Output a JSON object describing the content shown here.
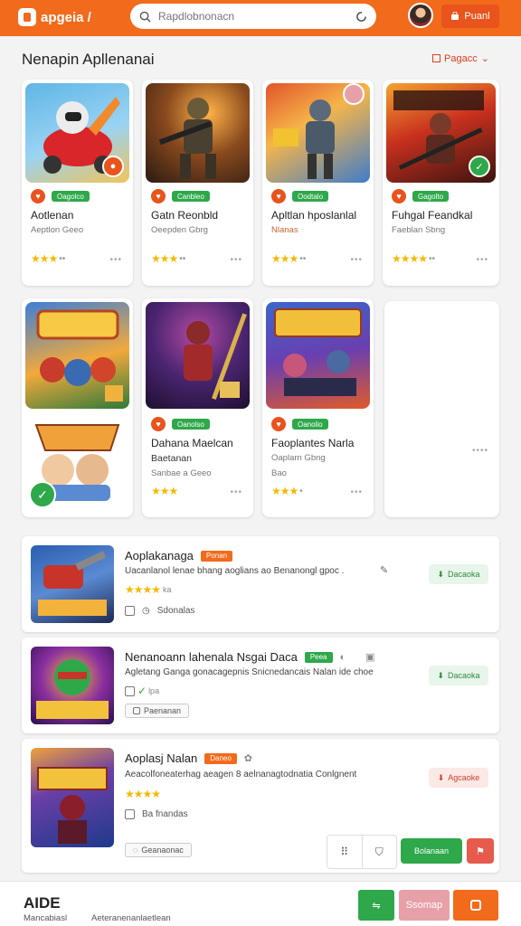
{
  "header": {
    "logo_text": "apgeia /",
    "search_placeholder": "Rapdlobnonacn",
    "action_label": "Puanl"
  },
  "section": {
    "title": "Nenapin Apllenanai",
    "action_label": "Pagacc"
  },
  "grid": [
    {
      "title": "Aotlenan",
      "sub": "Aeptlon Geeo",
      "pill": "Oagolco",
      "dots": "•••"
    },
    {
      "title": "Gatn Reonbld",
      "sub": "Oeepden Gbrg",
      "pill": "Canbleo",
      "dots": "•••"
    },
    {
      "title": "Apltlan hposlanlal",
      "sub": "Nlanas",
      "pill": "Oodtalo",
      "dots": "•••"
    },
    {
      "title": "Fuhgal Feandkal",
      "sub": "Faeblan Sbng",
      "pill": "Gagolto",
      "dots": "•••"
    },
    {
      "title": "",
      "sub": "",
      "pill": "",
      "dots": ""
    },
    {
      "title": "Dahana Maelcan",
      "sub": "Baetanan",
      "sub2": "Sanbae a Geeo",
      "pill": "Oanolso",
      "dots": "•••"
    },
    {
      "title": "Faoplantes Narla",
      "sub": "Oaplarn Gbng",
      "sub2": "Bao",
      "pill": "Oanolio",
      "dots": "•••"
    },
    {
      "title": "",
      "sub": "",
      "pill": "",
      "dots": "••••"
    }
  ],
  "list": [
    {
      "title": "Aoplakanaga",
      "tag": "Ponan",
      "desc": "Uacanlanol lenae bhang aoglians ao Benanongl gpoc .",
      "rating_label": "ka",
      "meta": "Sdonalas",
      "button": "Dacaoka"
    },
    {
      "title": "Nenanoann lahenala Nsgai Daca",
      "tag": "Peea",
      "desc": "Agletang Ganga gonacagepnis Snicnedancais Nalan ide choe",
      "rating_label": "lpa",
      "chip": "Paenanan",
      "button": "Dacaoka"
    },
    {
      "title": "Aoplasj Nalan",
      "tag": "Daneo",
      "desc": "Aeacolfoneaterhag aeagen 8 aelnanagtodnatia Conlgnent",
      "rating_label": "",
      "meta": "Ba fnandas",
      "chip": "Geanaonac",
      "button": "Agcaoke"
    }
  ],
  "bottom_actions": {
    "primary": "Bolanaan"
  },
  "footer": {
    "brand": "AIDE",
    "sub1": "Mancabiasl",
    "sub2": "Aeteranenanlaetlean",
    "btn_primary": "Ssomap"
  },
  "colors": {
    "brand": "#f26a1b",
    "green": "#2ea84a",
    "pink": "#e8a0a8",
    "red": "#e65b4c"
  }
}
